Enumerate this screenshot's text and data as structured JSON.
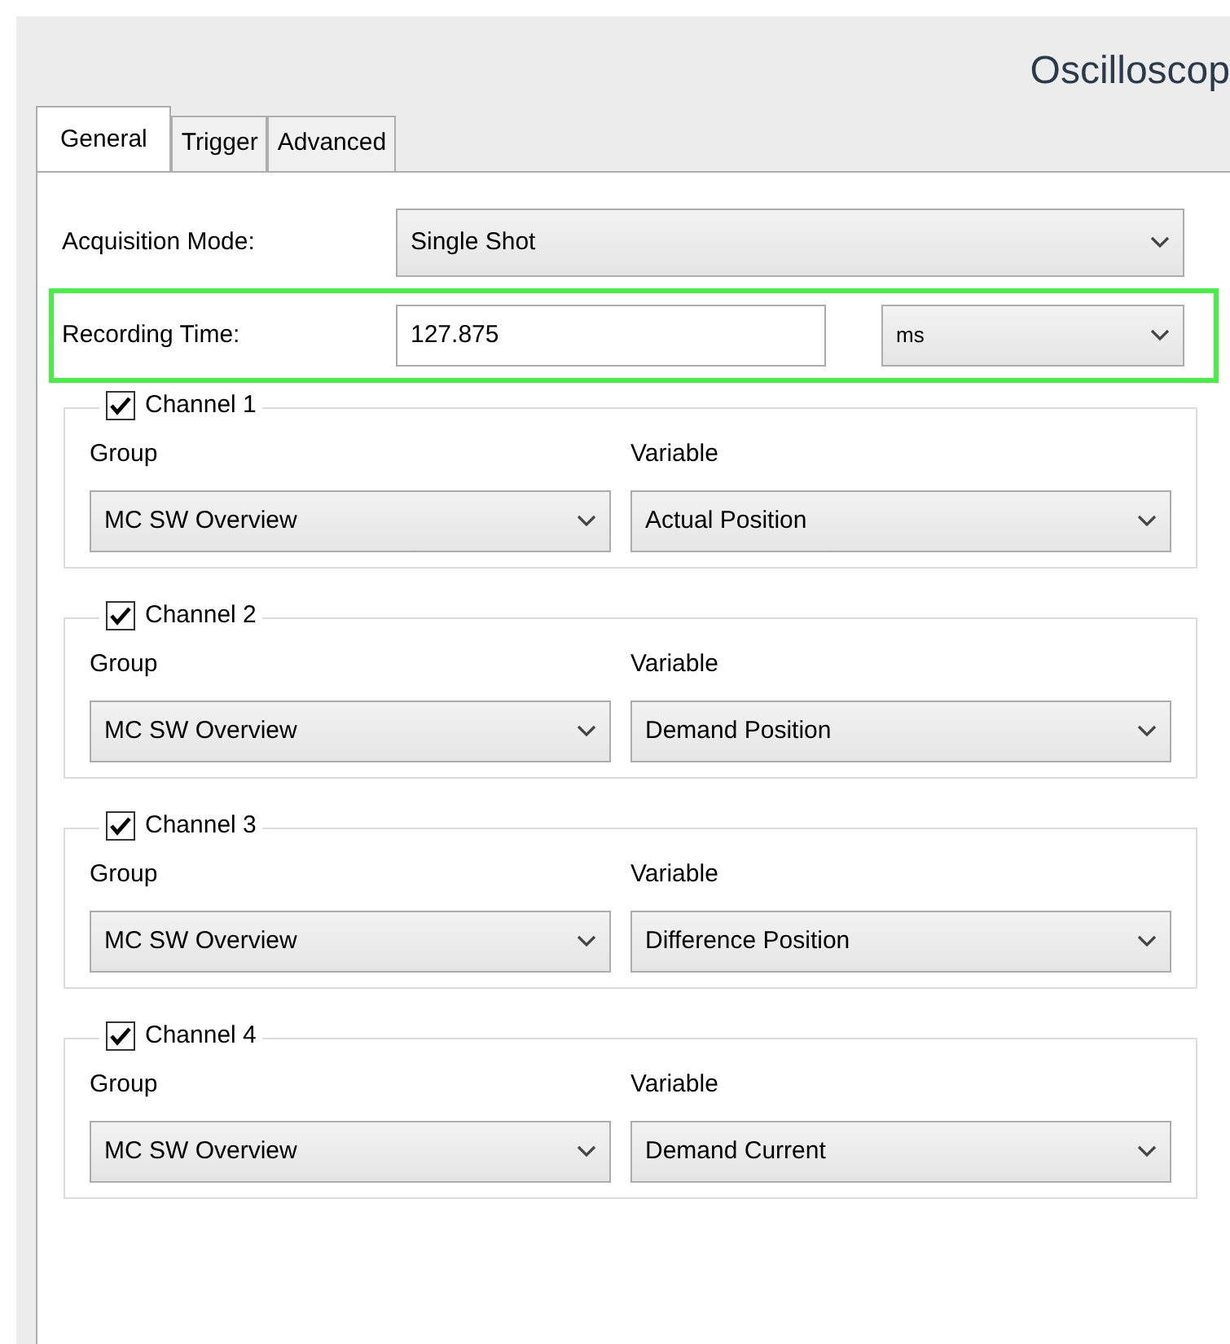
{
  "window": {
    "title": "Oscilloscop"
  },
  "tabs": [
    {
      "label": "General",
      "selected": true
    },
    {
      "label": "Trigger",
      "selected": false
    },
    {
      "label": "Advanced",
      "selected": false
    }
  ],
  "acquisition_mode": {
    "label": "Acquisition Mode:",
    "value": "Single Shot"
  },
  "recording_time": {
    "label": "Recording Time:",
    "value": "127.875",
    "unit": "ms",
    "highlighted": true
  },
  "channels": [
    {
      "label": "Channel 1",
      "checked": true,
      "group_label": "Group",
      "group": "MC SW Overview",
      "variable_label": "Variable",
      "variable": "Actual Position"
    },
    {
      "label": "Channel 2",
      "checked": true,
      "group_label": "Group",
      "group": "MC SW Overview",
      "variable_label": "Variable",
      "variable": "Demand Position"
    },
    {
      "label": "Channel 3",
      "checked": true,
      "group_label": "Group",
      "group": "MC SW Overview",
      "variable_label": "Variable",
      "variable": "Difference Position"
    },
    {
      "label": "Channel 4",
      "checked": true,
      "group_label": "Group",
      "group": "MC SW Overview",
      "variable_label": "Variable",
      "variable": "Demand Current"
    }
  ]
}
